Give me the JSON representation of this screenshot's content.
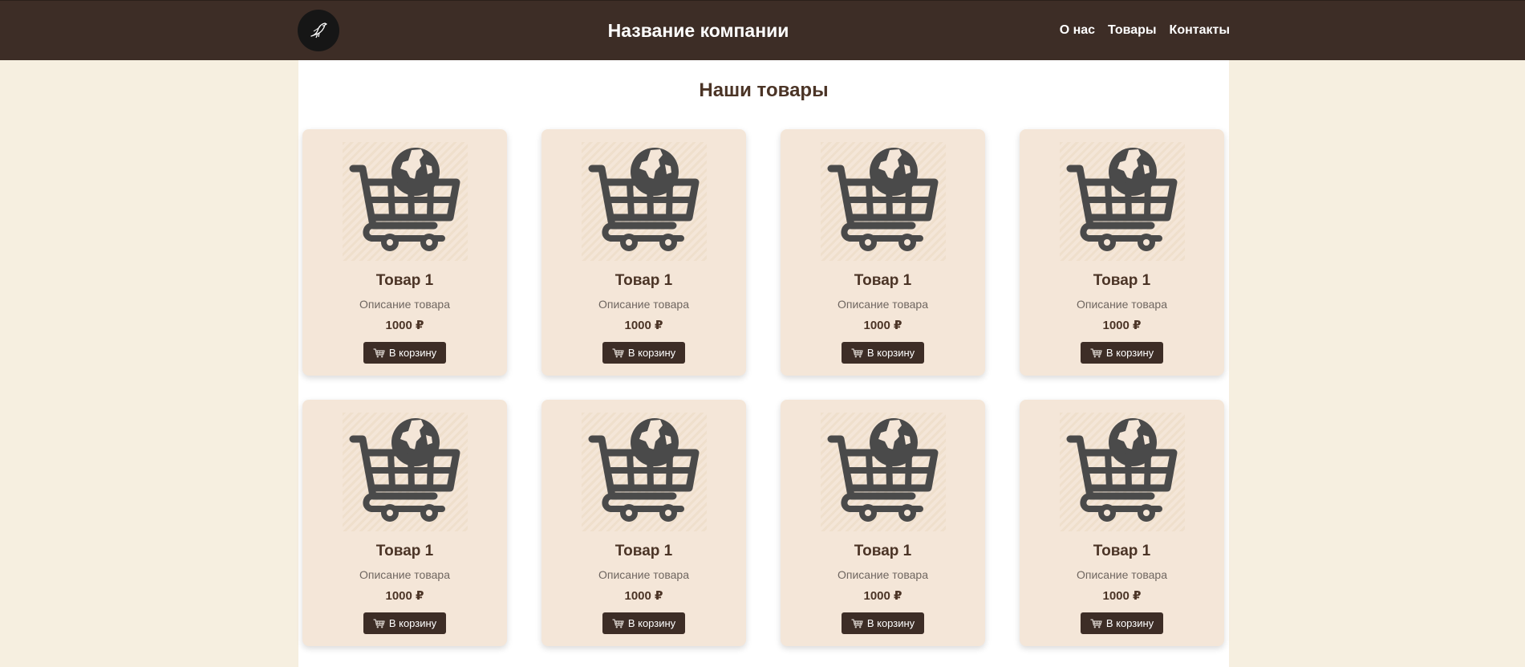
{
  "header": {
    "company_name": "Название компании",
    "nav": [
      "О нас",
      "Товары",
      "Контакты"
    ]
  },
  "main": {
    "section_title": "Наши товары",
    "products": [
      {
        "title": "Товар 1",
        "description": "Описание товара",
        "price": "1000 ₽",
        "button_label": "В корзину",
        "image_icon": "shopping-cart-globe-icon"
      },
      {
        "title": "Товар 1",
        "description": "Описание товара",
        "price": "1000 ₽",
        "button_label": "В корзину",
        "image_icon": "shopping-cart-globe-icon"
      },
      {
        "title": "Товар 1",
        "description": "Описание товара",
        "price": "1000 ₽",
        "button_label": "В корзину",
        "image_icon": "shopping-cart-globe-icon"
      },
      {
        "title": "Товар 1",
        "description": "Описание товара",
        "price": "1000 ₽",
        "button_label": "В корзину",
        "image_icon": "shopping-cart-globe-icon"
      },
      {
        "title": "Товар 1",
        "description": "Описание товара",
        "price": "1000 ₽",
        "button_label": "В корзину",
        "image_icon": "shopping-cart-globe-icon"
      },
      {
        "title": "Товар 1",
        "description": "Описание товара",
        "price": "1000 ₽",
        "button_label": "В корзину",
        "image_icon": "shopping-cart-globe-icon"
      },
      {
        "title": "Товар 1",
        "description": "Описание товара",
        "price": "1000 ₽",
        "button_label": "В корзину",
        "image_icon": "shopping-cart-globe-icon"
      },
      {
        "title": "Товар 1",
        "description": "Описание товара",
        "price": "1000 ₽",
        "button_label": "В корзину",
        "image_icon": "shopping-cart-globe-icon"
      }
    ]
  },
  "colors": {
    "header_bg": "#3d2d26",
    "page_bg": "#f6efe0",
    "card_bg": "#f4e6d8",
    "button_bg": "#3d2d26",
    "title_text": "#4b3426"
  },
  "icons": {
    "logo": "bird-icon",
    "button": "shopping-cart-icon"
  }
}
